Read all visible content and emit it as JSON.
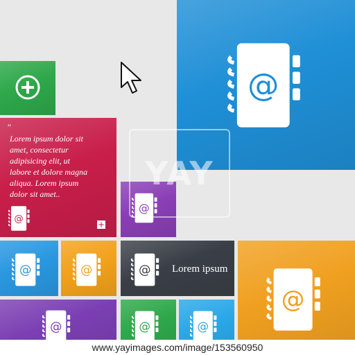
{
  "quote": {
    "mark": "\"",
    "lines": [
      "Lorem ipsum dolor sit",
      " amet, consectetur",
      "adipisicing elit, ut",
      "labore et dolore magna",
      " aliqua. Lorem ipsum",
      "dolor sit amet.."
    ]
  },
  "plain_label": "Lorem ipsum",
  "watermark": "YAY",
  "footer": "www.yayimages.com/image/153560950",
  "colors": {
    "blue": "#1f8fd6",
    "green": "#2ea84a",
    "red": "#c81e4a",
    "purple": "#7b3fb3",
    "orange": "#f0a020",
    "dark": "#3a3f47",
    "lightblue": "#2aa8e8",
    "gray": "#e8e8e8"
  },
  "icons": [
    "address-book-icon",
    "at-sign-icon",
    "plus-icon",
    "cursor-icon"
  ]
}
